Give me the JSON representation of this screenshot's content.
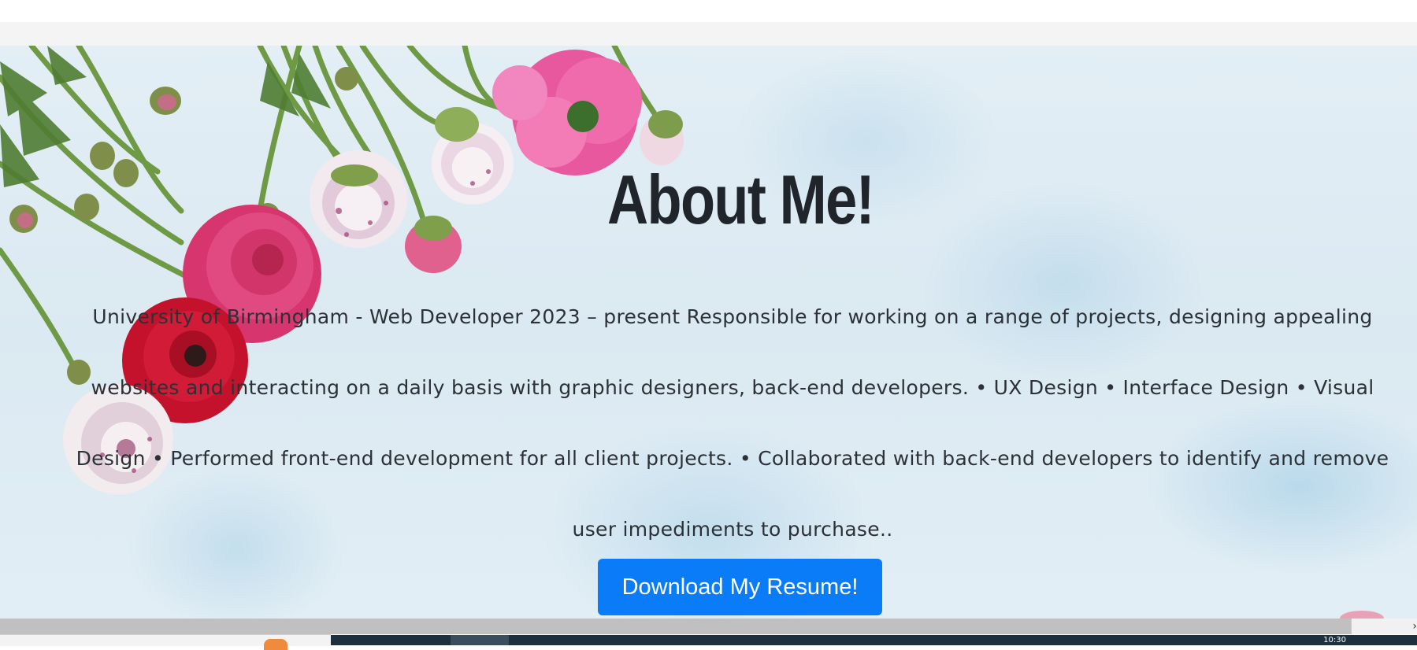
{
  "hero": {
    "title": "About Me!",
    "bio": "University of Birmingham - Web Developer 2023 – present Responsible for working on a range of projects, designing appealing websites and interacting on a daily basis with graphic designers, back-end developers. • UX Design • Interface Design • Visual Design • Performed front-end development for all client projects. • Collaborated with back-end developers to identify and remove user impediments to purchase..",
    "button_label": "Download My Resume!",
    "button_color": "#0a7cf7",
    "background_image": "floral-ranunculus-on-light-blue-texture"
  },
  "scrollbar": {
    "arrow_icon": "chevron-right-icon",
    "arrow_glyph": "›"
  },
  "taskbar": {
    "clock": "10:30"
  }
}
